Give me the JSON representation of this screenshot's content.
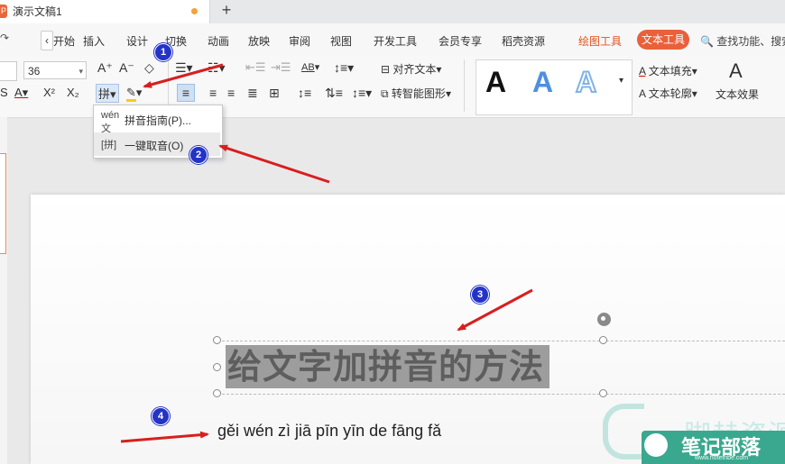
{
  "tab": {
    "icon": "P",
    "title": "演示文稿1",
    "new_tab": "+"
  },
  "menu": {
    "items": [
      "开始",
      "插入",
      "设计",
      "切换",
      "动画",
      "放映",
      "审阅",
      "视图",
      "开发工具",
      "会员专享",
      "稻壳资源"
    ],
    "drawing_tools": "绘图工具",
    "text_tools": "文本工具",
    "search_placeholder": "查找功能、搜索"
  },
  "ribbon": {
    "font_size": "36",
    "align_text": "对齐文本",
    "smartart": "转智能图形",
    "text_fill": "文本填充",
    "text_outline": "文本轮廓",
    "text_effects": "文本效果",
    "style_letter": "A",
    "superscript": "X²",
    "subscript": "X₂"
  },
  "dropdown": {
    "items": [
      {
        "label": "拼音指南(P)...",
        "icon": "pinyin-guide-icon"
      },
      {
        "label": "一键取音(O)",
        "icon": "one-key-pinyin-icon"
      }
    ]
  },
  "slide": {
    "title": "给文字加拼音的方法",
    "pinyin": "gěi wén zì jiā pīn yīn de fāng fǎ"
  },
  "annotations": [
    "1",
    "2",
    "3",
    "4"
  ],
  "colors": {
    "accent": "#e8613a",
    "arrow": "#d81f1f",
    "badge": "#2433c7",
    "selection": "#9d9d9d"
  },
  "watermark": {
    "top_text": "脚赫资源网",
    "label": "笔记部落",
    "url": "www.notetribe.com"
  }
}
